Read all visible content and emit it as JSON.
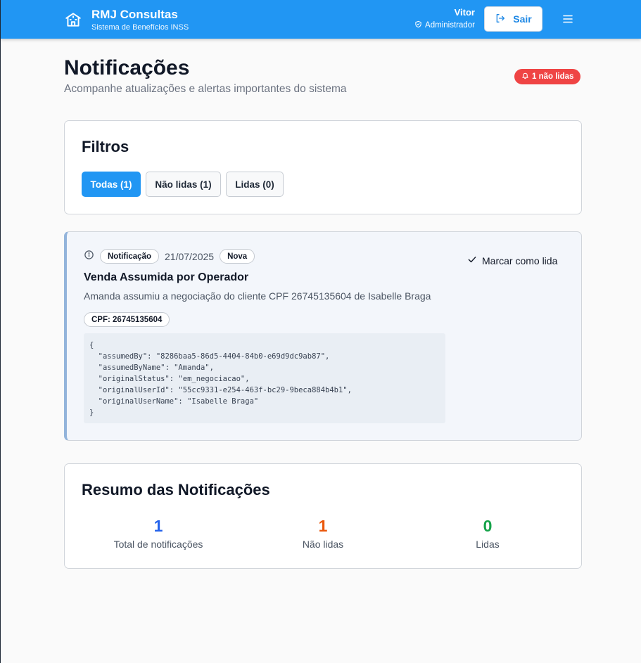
{
  "header": {
    "brand_title": "RMJ Consultas",
    "brand_subtitle": "Sistema de Benefícios INSS",
    "user_name": "Vitor",
    "user_role": "Administrador",
    "logout_label": "Sair"
  },
  "page": {
    "title": "Notificações",
    "subtitle": "Acompanhe atualizações e alertas importantes do sistema",
    "unread_badge": "1 não lidas"
  },
  "filters": {
    "title": "Filtros",
    "buttons": [
      {
        "label": "Todas (1)",
        "active": true
      },
      {
        "label": "Não lidas (1)",
        "active": false
      },
      {
        "label": "Lidas (0)",
        "active": false
      }
    ]
  },
  "notification": {
    "type_label": "Notificação",
    "date": "21/07/2025",
    "status_label": "Nova",
    "mark_read_label": "Marcar como lida",
    "title": "Venda Assumida por Operador",
    "message": "Amanda assumiu a negociação do cliente CPF 26745135604 de Isabelle Braga",
    "cpf_label": "CPF: 26745135604",
    "json": "{\n  \"assumedBy\": \"8286baa5-86d5-4404-84b0-e69d9dc9ab87\",\n  \"assumedByName\": \"Amanda\",\n  \"originalStatus\": \"em_negociacao\",\n  \"originalUserId\": \"55cc9331-e254-463f-bc29-9beca884b4b1\",\n  \"originalUserName\": \"Isabelle Braga\"\n}"
  },
  "summary": {
    "title": "Resumo das Notificações",
    "stats": [
      {
        "value": "1",
        "label": "Total de notificações",
        "color": "#2563eb"
      },
      {
        "value": "1",
        "label": "Não lidas",
        "color": "#ea580c"
      },
      {
        "value": "0",
        "label": "Lidas",
        "color": "#16a34a"
      }
    ]
  },
  "colors": {
    "primary": "#2196f3",
    "danger": "#ef4444"
  }
}
